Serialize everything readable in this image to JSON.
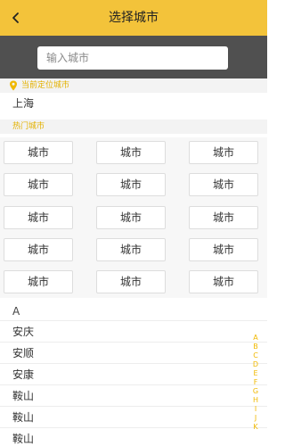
{
  "header": {
    "title": "选择城市"
  },
  "search": {
    "placeholder": "输入城市"
  },
  "location": {
    "label": "当前定位城市",
    "city": "上海"
  },
  "hot": {
    "label": "热门城市",
    "cities": [
      "城市",
      "城市",
      "城市",
      "城市",
      "城市",
      "城市",
      "城市",
      "城市",
      "城市",
      "城市",
      "城市",
      "城市",
      "城市",
      "城市",
      "城市"
    ]
  },
  "list": {
    "letter": "A",
    "items": [
      "安庆",
      "安顺",
      "安康",
      "鞍山",
      "鞍山",
      "鞍山"
    ]
  },
  "alphabet": [
    "A",
    "B",
    "C",
    "D",
    "E",
    "F",
    "G",
    "H",
    "I",
    "J",
    "K"
  ],
  "colors": {
    "accent": "#f3c33a",
    "search_band": "#505050",
    "index_letter": "#f0b800"
  }
}
